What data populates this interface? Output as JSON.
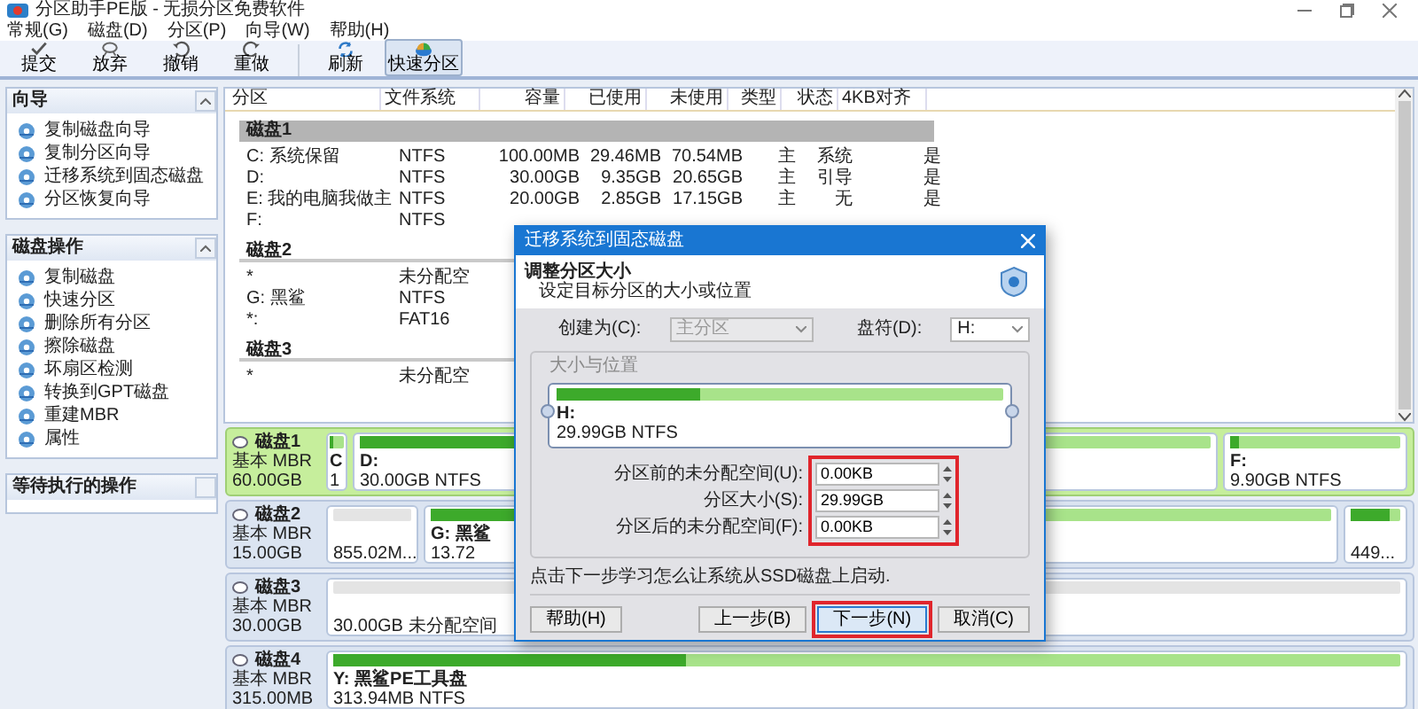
{
  "window": {
    "title": "分区助手PE版 - 无损分区免费软件"
  },
  "menu": [
    "常规(G)",
    "磁盘(D)",
    "分区(P)",
    "向导(W)",
    "帮助(H)"
  ],
  "toolbar": [
    [
      {
        "label": "提交",
        "kind": "commit",
        "selected": false
      },
      {
        "label": "放弃",
        "kind": "discard",
        "selected": false
      },
      {
        "label": "撤销",
        "kind": "undo",
        "selected": false
      },
      {
        "label": "重做",
        "kind": "redo",
        "selected": false
      }
    ],
    [
      {
        "label": "刷新",
        "kind": "refresh",
        "selected": false
      },
      {
        "label": "快速分区",
        "kind": "quick",
        "selected": true
      }
    ]
  ],
  "sidebar": [
    {
      "title": "向导",
      "expanded": true,
      "items": [
        "复制磁盘向导",
        "复制分区向导",
        "迁移系统到固态磁盘",
        "分区恢复向导"
      ]
    },
    {
      "title": "磁盘操作",
      "expanded": true,
      "items": [
        "复制磁盘",
        "快速分区",
        "删除所有分区",
        "擦除磁盘",
        "坏扇区检测",
        "转换到GPT磁盘",
        "重建MBR",
        "属性"
      ]
    },
    {
      "title": "等待执行的操作",
      "expanded": false
    }
  ],
  "table": {
    "columns": [
      "分区",
      "文件系统",
      "容量",
      "已使用",
      "未使用",
      "类型",
      "状态",
      "4KB对齐"
    ],
    "groups": [
      {
        "label": "磁盘1",
        "selected": true,
        "rows": [
          [
            "C: 系统保留",
            "NTFS",
            "100.00MB",
            "29.46MB",
            "70.54MB",
            "主",
            "系统",
            "是"
          ],
          [
            "D:",
            "NTFS",
            "30.00GB",
            "9.35GB",
            "20.65GB",
            "主",
            "引导",
            "是"
          ],
          [
            "E: 我的电脑我做主",
            "NTFS",
            "20.00GB",
            "2.85GB",
            "17.15GB",
            "主",
            "无",
            "是"
          ],
          [
            "F:",
            "NTFS"
          ]
        ]
      },
      {
        "label": "磁盘2",
        "selected": false,
        "rows": [
          [
            "*",
            "未分配空"
          ],
          [
            "G: 黑鲨",
            "NTFS"
          ],
          [
            "*:",
            "FAT16"
          ]
        ]
      },
      {
        "label": "磁盘3",
        "selected": false,
        "rows": [
          [
            "*",
            "未分配空"
          ]
        ]
      }
    ]
  },
  "disks": [
    {
      "name": "磁盘1",
      "type": "基本 MBR",
      "size": "60.00GB",
      "selected": true,
      "partitions": [
        {
          "kind": "tiny",
          "label": "C",
          "detail": "1",
          "level": 0.3
        },
        {
          "kind": "wide",
          "label": "D:",
          "detail": "30.00GB NTFS",
          "level": 0.3
        },
        {
          "kind": "medium",
          "label": "F:",
          "detail": "9.90GB NTFS",
          "level": 0.05
        }
      ]
    },
    {
      "name": "磁盘2",
      "type": "基本 MBR",
      "size": "15.00GB",
      "selected": false,
      "partitions": [
        {
          "kind": "unallocated",
          "detail": "855.02M..."
        },
        {
          "kind": "wide",
          "label": "G: 黑鲨",
          "detail": "13.72",
          "level": 0.5
        },
        {
          "kind": "narrow",
          "detail": "449...",
          "level": 0.8
        }
      ]
    },
    {
      "name": "磁盘3",
      "type": "基本 MBR",
      "size": "30.00GB",
      "selected": false,
      "partitions": [
        {
          "kind": "unallocated-wide",
          "detail": "30.00GB 未分配空间"
        }
      ]
    },
    {
      "name": "磁盘4",
      "type": "基本 MBR",
      "size": "315.00MB",
      "selected": false,
      "partitions": [
        {
          "kind": "wide",
          "label": "Y: 黑鲨PE工具盘",
          "detail": "313.94MB NTFS",
          "level": 0.33
        }
      ]
    }
  ],
  "dialog": {
    "title": "迁移系统到固态磁盘",
    "heading": "调整分区大小",
    "subheading": "设定目标分区的大小或位置",
    "create_as": {
      "label": "创建为(C):",
      "value": "主分区",
      "disabled": true
    },
    "drive_letter": {
      "label": "盘符(D):",
      "value": "H:",
      "disabled": false
    },
    "group_title": "大小与位置",
    "partition": {
      "label": "H:",
      "detail": "29.99GB NTFS",
      "level": 0.32
    },
    "fields_highlighted": true,
    "fields": [
      {
        "label": "分区前的未分配空间(U):",
        "value": "0.00KB"
      },
      {
        "label": "分区大小(S):",
        "value": "29.99GB"
      },
      {
        "label": "分区后的未分配空间(F):",
        "value": "0.00KB"
      }
    ],
    "note": "点击下一步学习怎么让系统从SSD磁盘上启动.",
    "buttons": [
      {
        "label": "帮助(H)",
        "highlighted": false
      },
      {
        "label": "上一步(B)",
        "highlighted": false
      },
      {
        "label": "下一步(N)",
        "highlighted": true
      },
      {
        "label": "取消(C)",
        "highlighted": false
      }
    ]
  }
}
